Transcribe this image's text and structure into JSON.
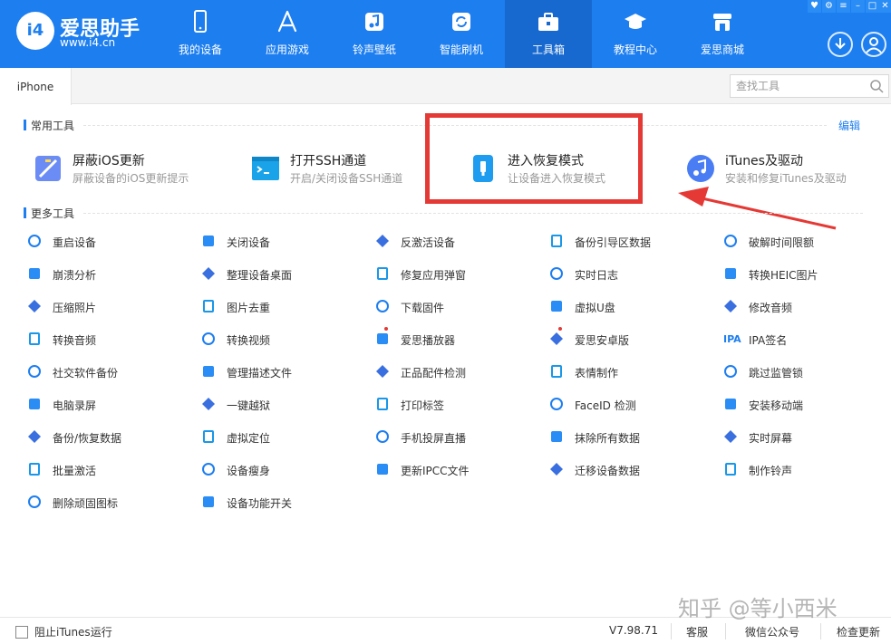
{
  "app": {
    "logo_mark": "i4",
    "name": "爱思助手",
    "url": "www.i4.cn",
    "accent": "#1d7ef0"
  },
  "nav": [
    {
      "label": "我的设备",
      "icon": "phone-icon"
    },
    {
      "label": "应用游戏",
      "icon": "app-store-icon"
    },
    {
      "label": "铃声壁纸",
      "icon": "music-note-icon"
    },
    {
      "label": "智能刷机",
      "icon": "refresh-icon"
    },
    {
      "label": "工具箱",
      "icon": "toolbox-icon",
      "active": true
    },
    {
      "label": "教程中心",
      "icon": "graduation-cap-icon"
    },
    {
      "label": "爱思商城",
      "icon": "store-icon"
    }
  ],
  "tabs": {
    "device_tab": "iPhone"
  },
  "search": {
    "placeholder": "查找工具"
  },
  "common_tools": {
    "title": "常用工具",
    "edit": "编辑",
    "items": [
      {
        "title": "屏蔽iOS更新",
        "subtitle": "屏蔽设备的iOS更新提示",
        "icon": "block-update-icon"
      },
      {
        "title": "打开SSH通道",
        "subtitle": "开启/关闭设备SSH通道",
        "icon": "terminal-icon"
      },
      {
        "title": "进入恢复模式",
        "subtitle": "让设备进入恢复模式",
        "icon": "recovery-mode-icon"
      },
      {
        "title": "iTunes及驱动",
        "subtitle": "安装和修复iTunes及驱动",
        "icon": "itunes-icon"
      }
    ]
  },
  "more_tools": {
    "title": "更多工具",
    "items": [
      "重启设备",
      "关闭设备",
      "反激活设备",
      "备份引导区数据",
      "破解时间限额",
      "崩溃分析",
      "整理设备桌面",
      "修复应用弹窗",
      "实时日志",
      "转换HEIC图片",
      "压缩照片",
      "图片去重",
      "下载固件",
      "虚拟U盘",
      "修改音频",
      "转换音频",
      "转换视频",
      "爱思播放器",
      "爱思安卓版",
      "IPA签名",
      "社交软件备份",
      "管理描述文件",
      "正品配件检测",
      "表情制作",
      "跳过监管锁",
      "电脑录屏",
      "一键越狱",
      "打印标签",
      "FaceID 检测",
      "安装移动端",
      "备份/恢复数据",
      "虚拟定位",
      "手机投屏直播",
      "抹除所有数据",
      "实时屏幕",
      "批量激活",
      "设备瘦身",
      "更新IPCC文件",
      "迁移设备数据",
      "制作铃声",
      "删除顽固图标",
      "设备功能开关"
    ],
    "new_badges": [
      "爱思播放器",
      "爱思安卓版"
    ],
    "ipa_icon_text": "IPA"
  },
  "status": {
    "block_itunes": "阻止iTunes运行",
    "version": "V7.98.71",
    "support": "客服",
    "wechat": "微信公众号",
    "update": "检查更新"
  },
  "watermark": "知乎 @等小西米",
  "highlight_color": "#e53935"
}
